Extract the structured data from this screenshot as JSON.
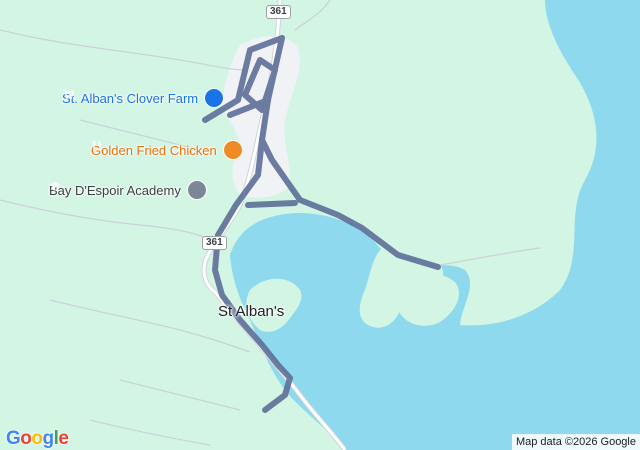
{
  "map": {
    "colors": {
      "land": "#d3f5e4",
      "water": "#8fd9ee",
      "urban": "#f1f2f5",
      "road": "#ffffff",
      "road_outline": "#cfd6db",
      "route": "#5d6f98",
      "shop_icon": "#1a73e8",
      "food_icon": "#f08a24",
      "school_icon": "#7b8794"
    },
    "pois": [
      {
        "id": "clover-farm",
        "name": "St. Alban's Clover Farm",
        "icon": "shopping-cart-icon",
        "color": "#1a73e8"
      },
      {
        "id": "golden-fried",
        "name": "Golden Fried Chicken",
        "icon": "restaurant-icon",
        "color": "#e8710a"
      },
      {
        "id": "academy",
        "name": "Bay D'Espoir Academy",
        "icon": "school-icon",
        "color": "#3c4043"
      }
    ],
    "road_shields": [
      "361",
      "361"
    ],
    "town_label": "St Alban's",
    "logo": "Google",
    "attribution": "Map data ©2026 Google"
  }
}
